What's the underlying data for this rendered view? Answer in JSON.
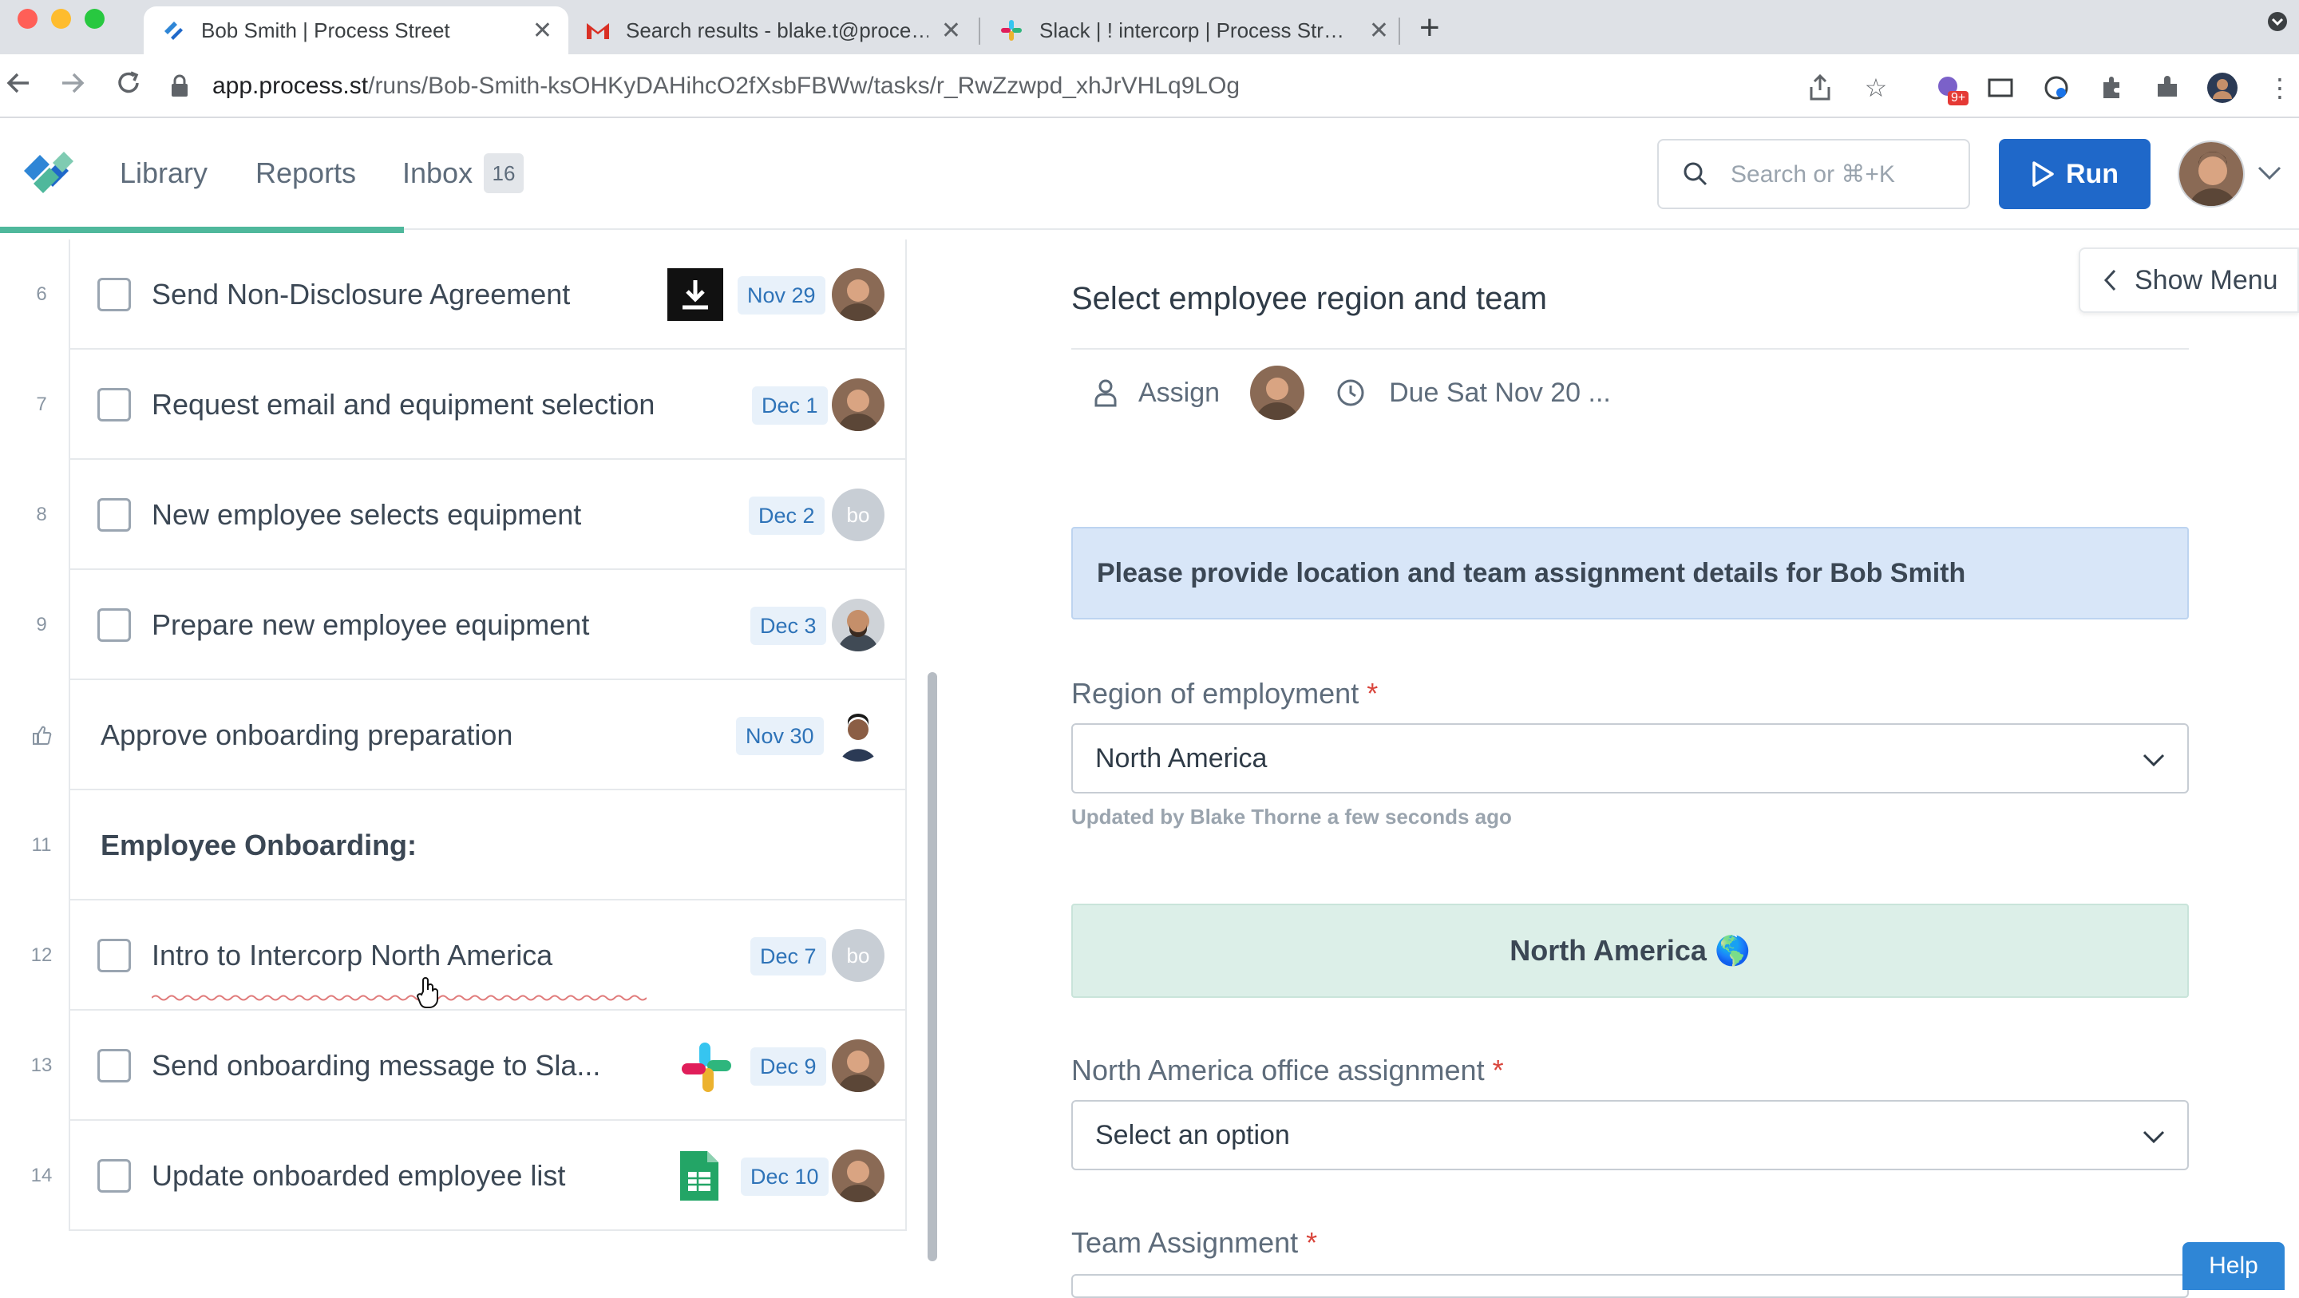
{
  "browser": {
    "tabs": [
      {
        "title": "Bob Smith | Process Street",
        "icon": "process-street-icon"
      },
      {
        "title": "Search results - blake.t@proce…",
        "icon": "gmail-icon"
      },
      {
        "title": "Slack | ! intercorp | Process Str…",
        "icon": "slack-icon"
      }
    ],
    "url_host": "app.process.st",
    "url_path": "/runs/Bob-Smith-ksOHKyDAHihcO2fXsbFBWw/tasks/r_RwZzwpd_xhJrVHLq9LOg",
    "extension_badge": "9+"
  },
  "app": {
    "nav": {
      "library": "Library",
      "reports": "Reports",
      "inbox": "Inbox",
      "inbox_count": "16"
    },
    "search_placeholder": "Search or ⌘+K",
    "run_label": "Run"
  },
  "tasks": [
    {
      "num": "6",
      "name": "Send Non-Disclosure Agreement",
      "due": "Nov 29",
      "icon": "download-icon",
      "checkbox": true
    },
    {
      "num": "7",
      "name": "Request email and equipment selection",
      "due": "Dec 1",
      "checkbox": true
    },
    {
      "num": "8",
      "name": "New employee selects equipment",
      "due": "Dec 2",
      "avatar_initials": "bo",
      "checkbox": true
    },
    {
      "num": "9",
      "name": "Prepare new employee equipment",
      "due": "Dec 3",
      "checkbox": true
    },
    {
      "num": "",
      "name": "Approve onboarding preparation",
      "due": "Nov 30",
      "icon": "thumbs-up-icon",
      "checkbox": false
    },
    {
      "num": "11",
      "name": "Employee Onboarding:",
      "heading": true
    },
    {
      "num": "12",
      "name": "Intro to Intercorp North America",
      "due": "Dec 7",
      "avatar_initials": "bo",
      "checkbox": true
    },
    {
      "num": "13",
      "name": "Send onboarding message to Sla...",
      "due": "Dec 9",
      "icon": "slack-icon",
      "checkbox": true
    },
    {
      "num": "14",
      "name": "Update onboarded employee list",
      "due": "Dec 10",
      "icon": "google-sheets-icon",
      "checkbox": true
    }
  ],
  "detail": {
    "show_menu": "Show Menu",
    "title": "Select employee region and team",
    "assign_label": "Assign",
    "due_label": "Due Sat Nov 20 ...",
    "info_text": "Please provide location and team assignment details for Bob Smith",
    "region_label": "Region of employment",
    "region_value": "North America",
    "updated_text": "Updated by Blake Thorne a few seconds ago",
    "region_banner": "North America 🌎",
    "office_label": "North America office assignment",
    "office_placeholder": "Select an option",
    "team_label": "Team Assignment",
    "required_mark": "*",
    "help_label": "Help"
  },
  "colors": {
    "primary": "#1f68c9",
    "progress": "#4fb89c",
    "info_bg": "#d8e6f8",
    "success_bg": "#dcefe8",
    "due_bg": "#e8f1fa"
  }
}
